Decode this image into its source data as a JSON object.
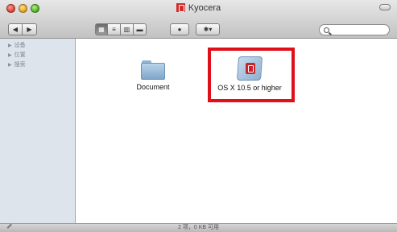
{
  "window": {
    "title": "Kyocera"
  },
  "toolbar": {
    "back_glyph": "◀",
    "forward_glyph": "▶",
    "view_icon_glyph": "▦",
    "view_list_glyph": "≡",
    "view_column_glyph": "▥",
    "view_coverflow_glyph": "▬",
    "quicklook_glyph": "●",
    "action_glyph": "✱▾",
    "search_value": ""
  },
  "sidebar": {
    "items": [
      {
        "label": "设备",
        "icon": "disclosure-triangle"
      },
      {
        "label": "位置",
        "icon": "disclosure-triangle"
      },
      {
        "label": "搜索",
        "icon": "disclosure-triangle"
      }
    ]
  },
  "content": {
    "items": [
      {
        "label": "Document",
        "icon": "folder-icon"
      },
      {
        "label": "OS X 10.5 or higher",
        "icon": "installer-package-icon",
        "highlighted": true
      }
    ]
  },
  "statusbar": {
    "text": "2 项，0 KB 可用"
  },
  "colors": {
    "highlight": "#e0101a",
    "sidebar_bg": "#dde4ec",
    "brand_red": "#c8262b"
  }
}
